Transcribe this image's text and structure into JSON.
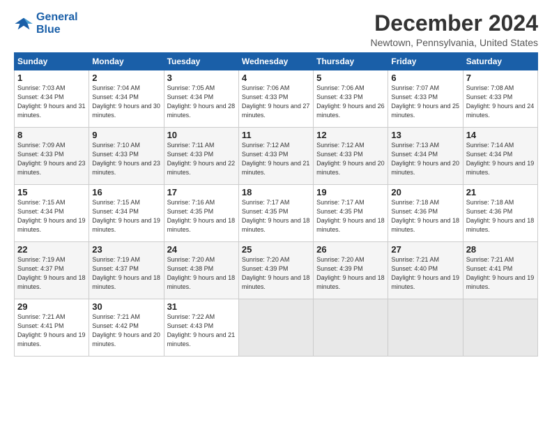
{
  "logo": {
    "general": "General",
    "blue": "Blue"
  },
  "title": "December 2024",
  "location": "Newtown, Pennsylvania, United States",
  "days_header": [
    "Sunday",
    "Monday",
    "Tuesday",
    "Wednesday",
    "Thursday",
    "Friday",
    "Saturday"
  ],
  "weeks": [
    [
      {
        "num": "1",
        "sunrise": "7:03 AM",
        "sunset": "4:34 PM",
        "daylight": "9 hours and 31 minutes."
      },
      {
        "num": "2",
        "sunrise": "7:04 AM",
        "sunset": "4:34 PM",
        "daylight": "9 hours and 30 minutes."
      },
      {
        "num": "3",
        "sunrise": "7:05 AM",
        "sunset": "4:34 PM",
        "daylight": "9 hours and 28 minutes."
      },
      {
        "num": "4",
        "sunrise": "7:06 AM",
        "sunset": "4:33 PM",
        "daylight": "9 hours and 27 minutes."
      },
      {
        "num": "5",
        "sunrise": "7:06 AM",
        "sunset": "4:33 PM",
        "daylight": "9 hours and 26 minutes."
      },
      {
        "num": "6",
        "sunrise": "7:07 AM",
        "sunset": "4:33 PM",
        "daylight": "9 hours and 25 minutes."
      },
      {
        "num": "7",
        "sunrise": "7:08 AM",
        "sunset": "4:33 PM",
        "daylight": "9 hours and 24 minutes."
      }
    ],
    [
      {
        "num": "8",
        "sunrise": "7:09 AM",
        "sunset": "4:33 PM",
        "daylight": "9 hours and 23 minutes."
      },
      {
        "num": "9",
        "sunrise": "7:10 AM",
        "sunset": "4:33 PM",
        "daylight": "9 hours and 23 minutes."
      },
      {
        "num": "10",
        "sunrise": "7:11 AM",
        "sunset": "4:33 PM",
        "daylight": "9 hours and 22 minutes."
      },
      {
        "num": "11",
        "sunrise": "7:12 AM",
        "sunset": "4:33 PM",
        "daylight": "9 hours and 21 minutes."
      },
      {
        "num": "12",
        "sunrise": "7:12 AM",
        "sunset": "4:33 PM",
        "daylight": "9 hours and 20 minutes."
      },
      {
        "num": "13",
        "sunrise": "7:13 AM",
        "sunset": "4:34 PM",
        "daylight": "9 hours and 20 minutes."
      },
      {
        "num": "14",
        "sunrise": "7:14 AM",
        "sunset": "4:34 PM",
        "daylight": "9 hours and 19 minutes."
      }
    ],
    [
      {
        "num": "15",
        "sunrise": "7:15 AM",
        "sunset": "4:34 PM",
        "daylight": "9 hours and 19 minutes."
      },
      {
        "num": "16",
        "sunrise": "7:15 AM",
        "sunset": "4:34 PM",
        "daylight": "9 hours and 19 minutes."
      },
      {
        "num": "17",
        "sunrise": "7:16 AM",
        "sunset": "4:35 PM",
        "daylight": "9 hours and 18 minutes."
      },
      {
        "num": "18",
        "sunrise": "7:17 AM",
        "sunset": "4:35 PM",
        "daylight": "9 hours and 18 minutes."
      },
      {
        "num": "19",
        "sunrise": "7:17 AM",
        "sunset": "4:35 PM",
        "daylight": "9 hours and 18 minutes."
      },
      {
        "num": "20",
        "sunrise": "7:18 AM",
        "sunset": "4:36 PM",
        "daylight": "9 hours and 18 minutes."
      },
      {
        "num": "21",
        "sunrise": "7:18 AM",
        "sunset": "4:36 PM",
        "daylight": "9 hours and 18 minutes."
      }
    ],
    [
      {
        "num": "22",
        "sunrise": "7:19 AM",
        "sunset": "4:37 PM",
        "daylight": "9 hours and 18 minutes."
      },
      {
        "num": "23",
        "sunrise": "7:19 AM",
        "sunset": "4:37 PM",
        "daylight": "9 hours and 18 minutes."
      },
      {
        "num": "24",
        "sunrise": "7:20 AM",
        "sunset": "4:38 PM",
        "daylight": "9 hours and 18 minutes."
      },
      {
        "num": "25",
        "sunrise": "7:20 AM",
        "sunset": "4:39 PM",
        "daylight": "9 hours and 18 minutes."
      },
      {
        "num": "26",
        "sunrise": "7:20 AM",
        "sunset": "4:39 PM",
        "daylight": "9 hours and 18 minutes."
      },
      {
        "num": "27",
        "sunrise": "7:21 AM",
        "sunset": "4:40 PM",
        "daylight": "9 hours and 19 minutes."
      },
      {
        "num": "28",
        "sunrise": "7:21 AM",
        "sunset": "4:41 PM",
        "daylight": "9 hours and 19 minutes."
      }
    ],
    [
      {
        "num": "29",
        "sunrise": "7:21 AM",
        "sunset": "4:41 PM",
        "daylight": "9 hours and 19 minutes."
      },
      {
        "num": "30",
        "sunrise": "7:21 AM",
        "sunset": "4:42 PM",
        "daylight": "9 hours and 20 minutes."
      },
      {
        "num": "31",
        "sunrise": "7:22 AM",
        "sunset": "4:43 PM",
        "daylight": "9 hours and 21 minutes."
      },
      null,
      null,
      null,
      null
    ]
  ]
}
